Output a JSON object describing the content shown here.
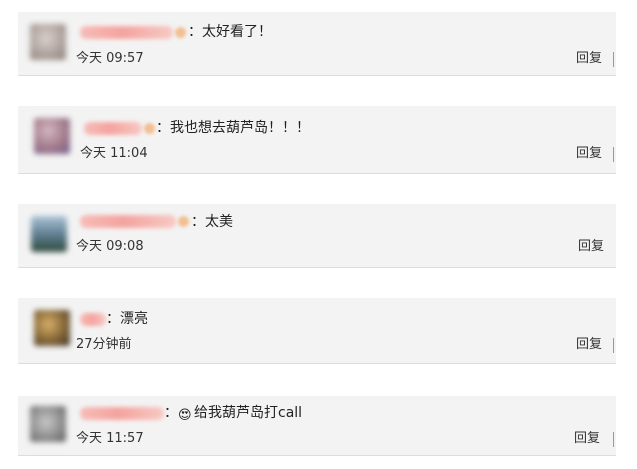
{
  "comments": [
    {
      "text": "太好看了！",
      "time": "今天 09:57",
      "reply": "回复",
      "avatar_color": "#b7aba6",
      "emoji": ""
    },
    {
      "text": "我也想去葫芦岛！！！",
      "time": "今天 11:04",
      "reply": "回复",
      "avatar_color": "#a77f8c",
      "emoji": ""
    },
    {
      "text": "太美",
      "time": "今天 09:08",
      "reply": "回复",
      "avatar_color": "#5b7a8c",
      "emoji": ""
    },
    {
      "text": "漂亮",
      "time": "27分钟前",
      "reply": "回复",
      "avatar_color": "#8a6b3a",
      "emoji": ""
    },
    {
      "text": "给我葫芦岛打call",
      "time": "今天 11:57",
      "reply": "回复",
      "avatar_color": "#8f8f8f",
      "emoji": "😍"
    }
  ],
  "separator": "："
}
